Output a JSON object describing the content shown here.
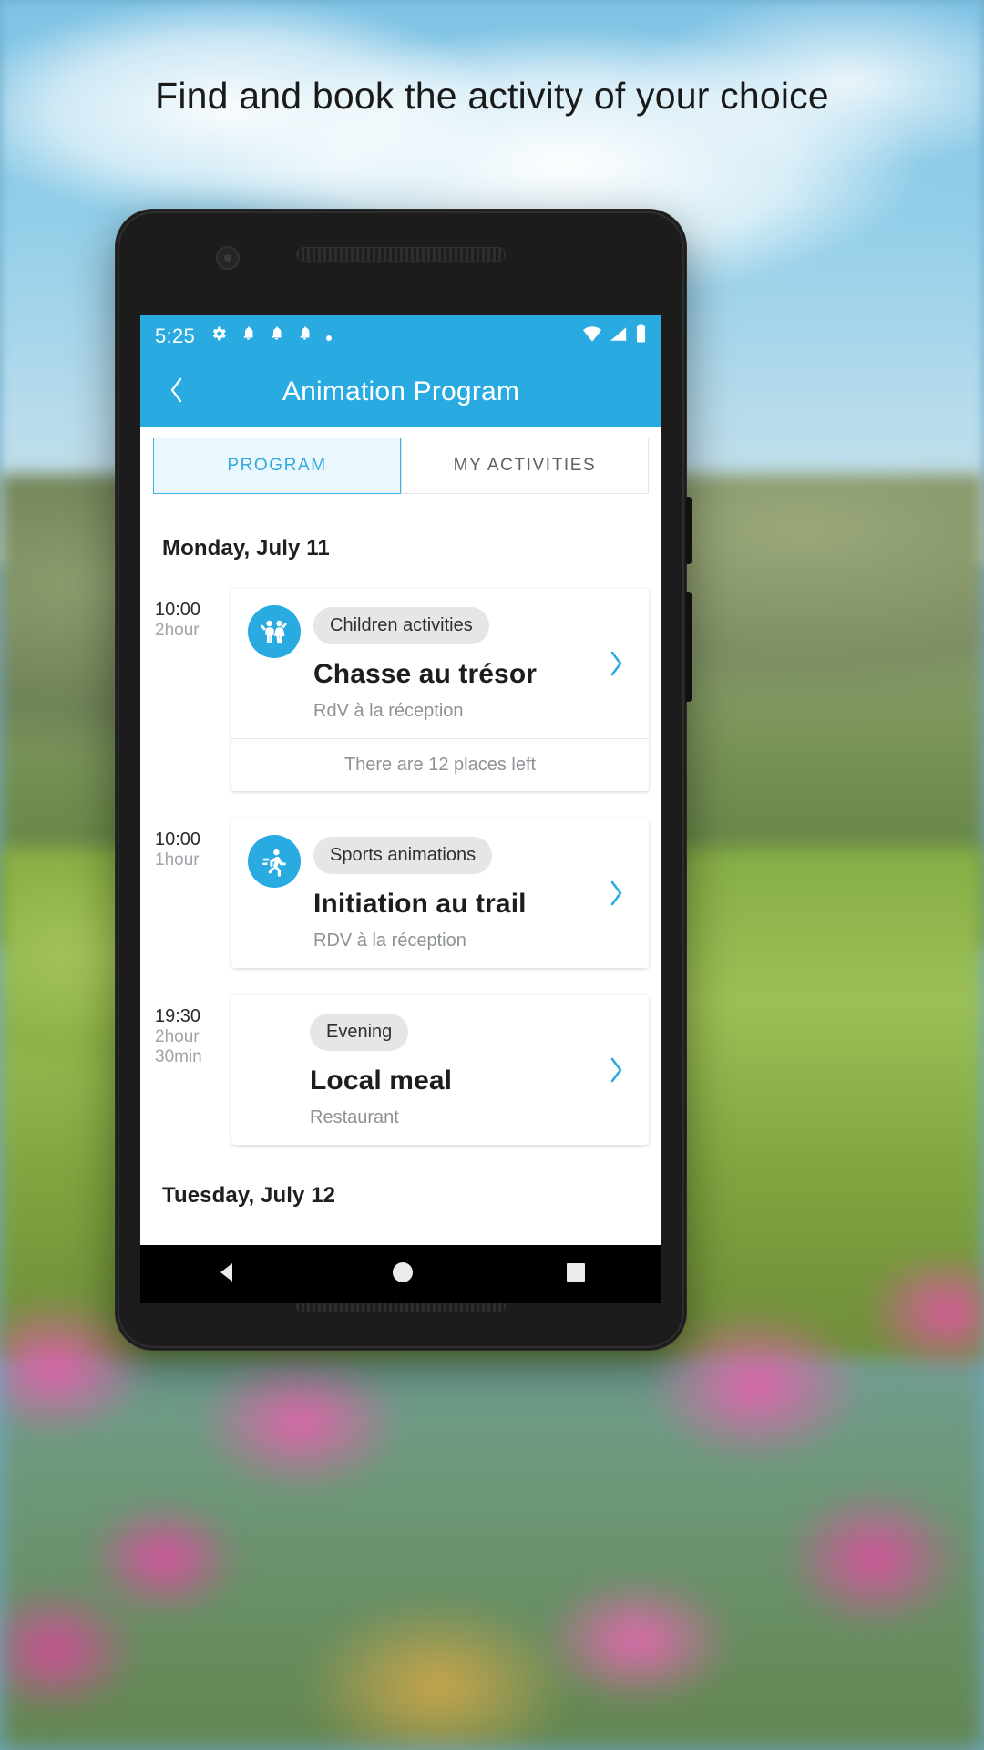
{
  "headline": "Find and book the activity of your choice",
  "phone": {
    "status_bar": {
      "time": "5:25",
      "left_icons": [
        "gear-icon",
        "bell-icon",
        "bell-icon",
        "bell-icon",
        "dot-icon"
      ],
      "right_icons": [
        "wifi-icon",
        "signal-icon",
        "battery-icon"
      ]
    },
    "app_bar": {
      "back_icon": "chevron-left-icon",
      "title": "Animation Program"
    },
    "tabs": [
      {
        "label": "PROGRAM",
        "active": true
      },
      {
        "label": "MY ACTIVITIES",
        "active": false
      }
    ],
    "days": [
      {
        "date_label": "Monday, July 11",
        "activities": [
          {
            "time": "10:00",
            "duration": "2hour",
            "icon": "children-icon",
            "category": "Children activities",
            "title": "Chasse au trésor",
            "location": "RdV à la réception",
            "footer": "There are 12 places left",
            "chevron": "chevron-right-icon"
          },
          {
            "time": "10:00",
            "duration": "1hour",
            "icon": "running-icon",
            "category": "Sports animations",
            "title": "Initiation au trail",
            "location": "RDV à la réception",
            "footer": "",
            "chevron": "chevron-right-icon"
          },
          {
            "time": "19:30",
            "duration": "2hour\n30min",
            "icon": "",
            "category": "Evening",
            "title": "Local meal",
            "location": "Restaurant",
            "footer": "",
            "chevron": "chevron-right-icon"
          }
        ]
      },
      {
        "date_label": "Tuesday, July 12",
        "activities": []
      }
    ],
    "nav_bar": {
      "back": "triangle-back-icon",
      "home": "circle-home-icon",
      "recents": "square-recents-icon"
    }
  },
  "colors": {
    "accent": "#29abe2",
    "tab_active_bg": "#eaf7fd",
    "chip_bg": "#e6e6e6",
    "muted_text": "#8d9296"
  }
}
